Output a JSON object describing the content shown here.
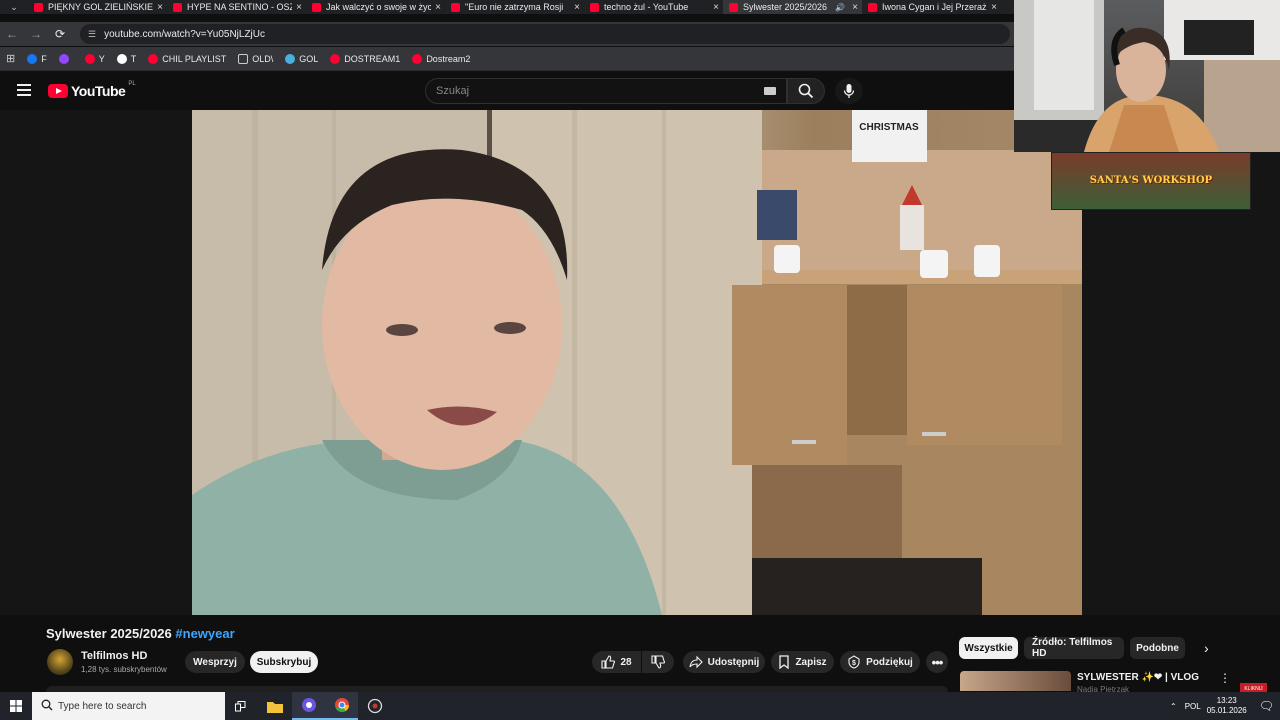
{
  "browser": {
    "tabs": [
      {
        "title": "PIĘKNY GOL ZIELIŃSKIEGO",
        "active": false,
        "audio": false
      },
      {
        "title": "HYPE NA SENTINO - OSZ",
        "active": false,
        "audio": false
      },
      {
        "title": "Jak walczyć o swoje w życ",
        "active": false,
        "audio": false
      },
      {
        "title": "\"Euro nie zatrzyma Rosji",
        "active": false,
        "audio": false
      },
      {
        "title": "techno żul - YouTube",
        "active": false,
        "audio": false
      },
      {
        "title": "Sylwester 2025/2026",
        "active": true,
        "audio": true
      },
      {
        "title": "Iwona Cygan i Jej Przeraż",
        "active": false,
        "audio": false
      }
    ],
    "url": "youtube.com/watch?v=Yu05NjLZjUc",
    "bookmarks": [
      {
        "label": "F",
        "icon": "facebook-icon",
        "color": "#1877f2"
      },
      {
        "label": "",
        "icon": "twitch-icon",
        "color": "#9146ff"
      },
      {
        "label": "Y",
        "icon": "youtube-icon",
        "color": "#ff0033"
      },
      {
        "label": "T",
        "icon": "x-icon",
        "color": "#ffffff"
      },
      {
        "label": "CHIL PLAYLIST",
        "icon": "youtube-icon",
        "color": "#ff0033"
      },
      {
        "label": "OLD\\",
        "icon": "folder-icon",
        "color": "#cccccc"
      },
      {
        "label": "GOL",
        "icon": "gol-icon",
        "color": "#4ab0e0"
      },
      {
        "label": "DOSTREAM1",
        "icon": "youtube-icon",
        "color": "#ff0033"
      },
      {
        "label": "Dostream2",
        "icon": "youtube-icon",
        "color": "#ff0033"
      }
    ]
  },
  "youtube": {
    "logo_text": "YouTube",
    "logo_region": "PL",
    "search_placeholder": "Szukaj",
    "video": {
      "title": "Sylwester 2025/2026",
      "hashtag": "#newyear",
      "channel": "Telfilmos HD",
      "subscribers": "1,28 tys. subskrybentów",
      "support_label": "Wesprzyj",
      "subscribe_label": "Subskrybuj",
      "likes": "28",
      "share_label": "Udostępnij",
      "save_label": "Zapisz",
      "thanks_label": "Podziękuj",
      "scene_sign_text": "CHRISTMAS"
    },
    "chips": [
      "Wszystkie",
      "Źródło: Telfilmos HD",
      "Podobne"
    ],
    "recommendation": {
      "title": "SYLWESTER ✨❤ | VLOG",
      "channel": "Nadia Pietrzak"
    }
  },
  "stream_overlay": {
    "banner_text": "SANTA'S WORKSHOP",
    "corner_badge": "KLIKNIJ"
  },
  "taskbar": {
    "search_placeholder": "Type here to search",
    "language": "POL",
    "time": "13:23",
    "date": "05.01.2026"
  }
}
